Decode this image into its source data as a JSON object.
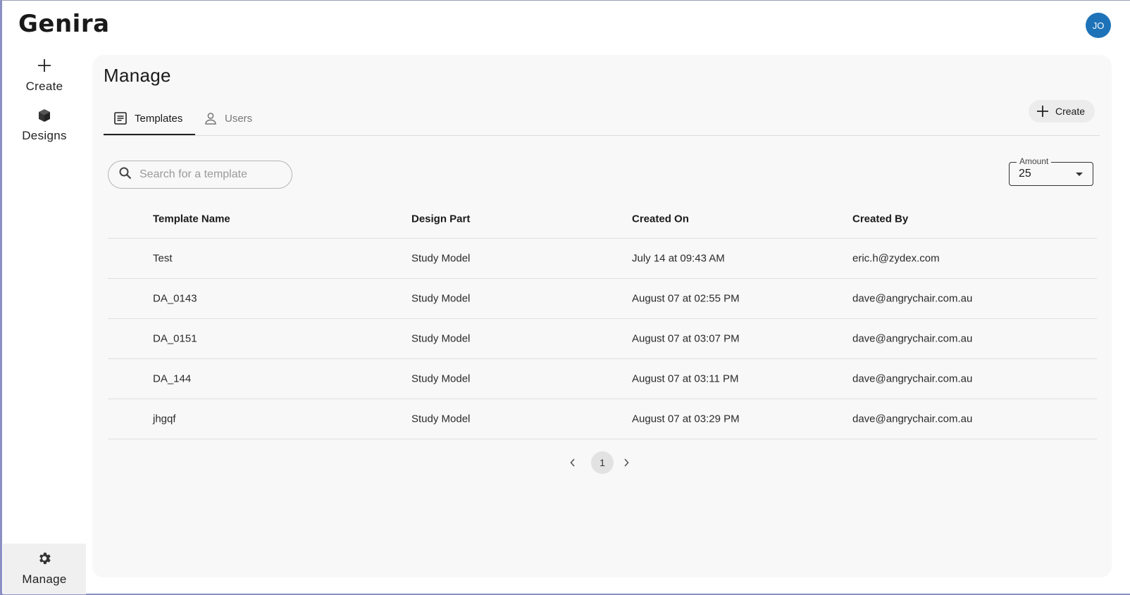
{
  "app": {
    "logo": "Genira",
    "avatar_initials": "JO"
  },
  "sidebar": {
    "items": [
      {
        "label": "Create",
        "icon": "plus-icon"
      },
      {
        "label": "Designs",
        "icon": "cube-icon"
      },
      {
        "label": "Manage",
        "icon": "gear-icon",
        "active": true
      }
    ]
  },
  "main": {
    "title": "Manage",
    "tabs": [
      {
        "label": "Templates",
        "icon": "document-icon",
        "active": true
      },
      {
        "label": "Users",
        "icon": "user-icon",
        "active": false
      }
    ],
    "create_label": "Create",
    "search": {
      "placeholder": "Search for a template",
      "value": ""
    },
    "amount": {
      "label": "Amount",
      "value": "25"
    }
  },
  "table": {
    "columns": [
      "Template Name",
      "Design Part",
      "Created On",
      "Created By"
    ],
    "rows": [
      [
        "Test",
        "Study Model",
        "July 14 at 09:43 AM",
        "eric.h@zydex.com"
      ],
      [
        "DA_0143",
        "Study Model",
        "August 07 at 02:55 PM",
        "dave@angrychair.com.au"
      ],
      [
        "DA_0151",
        "Study Model",
        "August 07 at 03:07 PM",
        "dave@angrychair.com.au"
      ],
      [
        "DA_144",
        "Study Model",
        "August 07 at 03:11 PM",
        "dave@angrychair.com.au"
      ],
      [
        "jhgqf",
        "Study Model",
        "August 07 at 03:29 PM",
        "dave@angrychair.com.au"
      ]
    ]
  },
  "pagination": {
    "current_page": "1"
  },
  "colors": {
    "accent": "#1e73b8",
    "panel_bg": "#f8f8f8"
  }
}
